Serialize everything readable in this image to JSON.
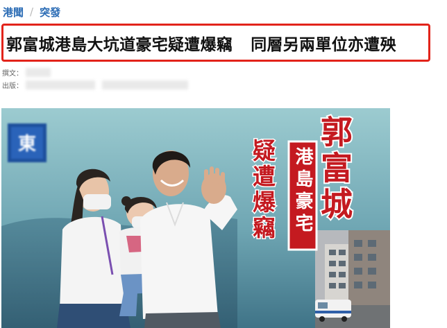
{
  "breadcrumb": {
    "section": "港聞",
    "separator": "/",
    "subsection": "突發"
  },
  "article": {
    "headline_main": "郭富城港島大坑道豪宅疑遭爆竊",
    "headline_sub": "同層另兩單位亦遭殃",
    "author_label": "撰文：",
    "published_label": "出版："
  },
  "hero_image": {
    "title_name": "郭富城",
    "title_place": "港島豪宅",
    "title_event": "疑遭爆竊",
    "logo_glyph": "東"
  },
  "colors": {
    "link_blue": "#2b6cb5",
    "highlight_red": "#e2231a",
    "hero_title_red": "#c41a20",
    "logo_blue": "#1d4f9c"
  }
}
